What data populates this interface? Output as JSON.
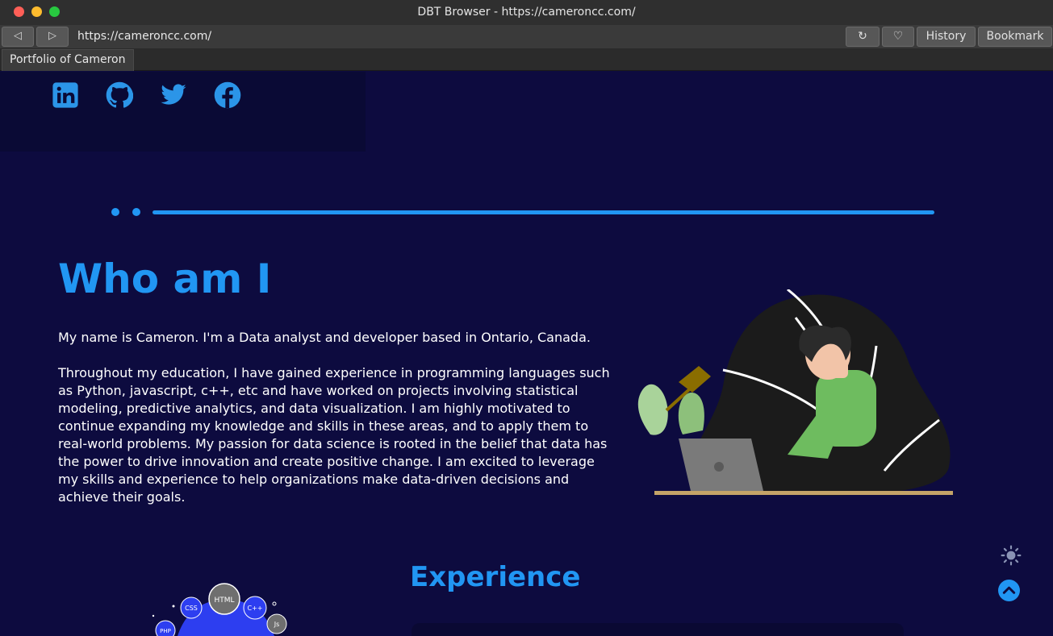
{
  "window": {
    "title": "DBT Browser - https://cameroncc.com/"
  },
  "toolbar": {
    "back_label": "◁",
    "forward_label": "▷",
    "url": "https://cameroncc.com/",
    "reload_label": "↻",
    "favorite_label": "♡",
    "history_label": "History",
    "bookmark_label": "Bookmark"
  },
  "tabs": [
    {
      "label": "Portfolio of Cameron"
    }
  ],
  "social": [
    {
      "icon": "linkedin-icon"
    },
    {
      "icon": "github-icon"
    },
    {
      "icon": "twitter-icon"
    },
    {
      "icon": "facebook-icon"
    }
  ],
  "about": {
    "title": "Who am I",
    "intro": "My name is Cameron. I'm a Data analyst and developer based in Ontario, Canada.",
    "bio": "Throughout my education, I have gained experience in programming languages such as Python, javascript, c++, etc and have worked on projects involving statistical modeling, predictive analytics, and data visualization. I am highly motivated to continue expanding my knowledge and skills in these areas, and to apply them to real-world problems. My passion for data science is rooted in the belief that data has the power to drive innovation and create positive change. I am excited to leverage my skills and experience to help organizations make data-driven decisions and achieve their goals."
  },
  "experience": {
    "title": "Experience"
  },
  "skills": [
    "CSS",
    "HTML",
    "C++",
    "Js",
    "PHP"
  ],
  "colors": {
    "accent": "#2196f3",
    "page_bg": "#0d0b3f"
  }
}
